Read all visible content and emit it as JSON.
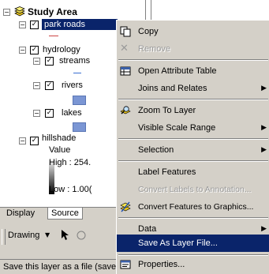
{
  "toc": {
    "root_label": "Study Area",
    "layers": [
      {
        "label": "park roads",
        "checked": true,
        "selected": true
      },
      {
        "label": "hydrology",
        "checked": true
      },
      {
        "label": "streams",
        "checked": true
      },
      {
        "label": "rivers",
        "checked": true
      },
      {
        "label": "lakes",
        "checked": true
      },
      {
        "label": "hillshade",
        "checked": true
      }
    ],
    "hillshade_legend": {
      "value_label": "Value",
      "high_label": "High : 254.",
      "low_label": "Low : 1.00("
    }
  },
  "tabs": {
    "display": "Display",
    "source": "Source"
  },
  "toolbar": {
    "drawing_label": "Drawing",
    "dropdown_arrow": "▼",
    "pointer_icon": "arrow-pointer-icon"
  },
  "status_text": "Save this layer as a file (save",
  "context_menu": {
    "copy": "Copy",
    "remove": "Remove",
    "open_attribute_table": "Open Attribute Table",
    "joins_and_relates": "Joins and Relates",
    "zoom_to_layer": "Zoom To Layer",
    "visible_scale_range": "Visible Scale Range",
    "selection": "Selection",
    "label_features": "Label Features",
    "convert_labels": "Convert Labels to Annotation...",
    "convert_features": "Convert Features to Graphics...",
    "data": "Data",
    "save_as_layer_file": "Save As Layer File...",
    "properties": "Properties...",
    "submenu_arrow": "▶"
  },
  "colors": {
    "menu_background": "#d4d0c8",
    "highlight": "#0a246a",
    "lake_swatch": "#7b96d4"
  }
}
